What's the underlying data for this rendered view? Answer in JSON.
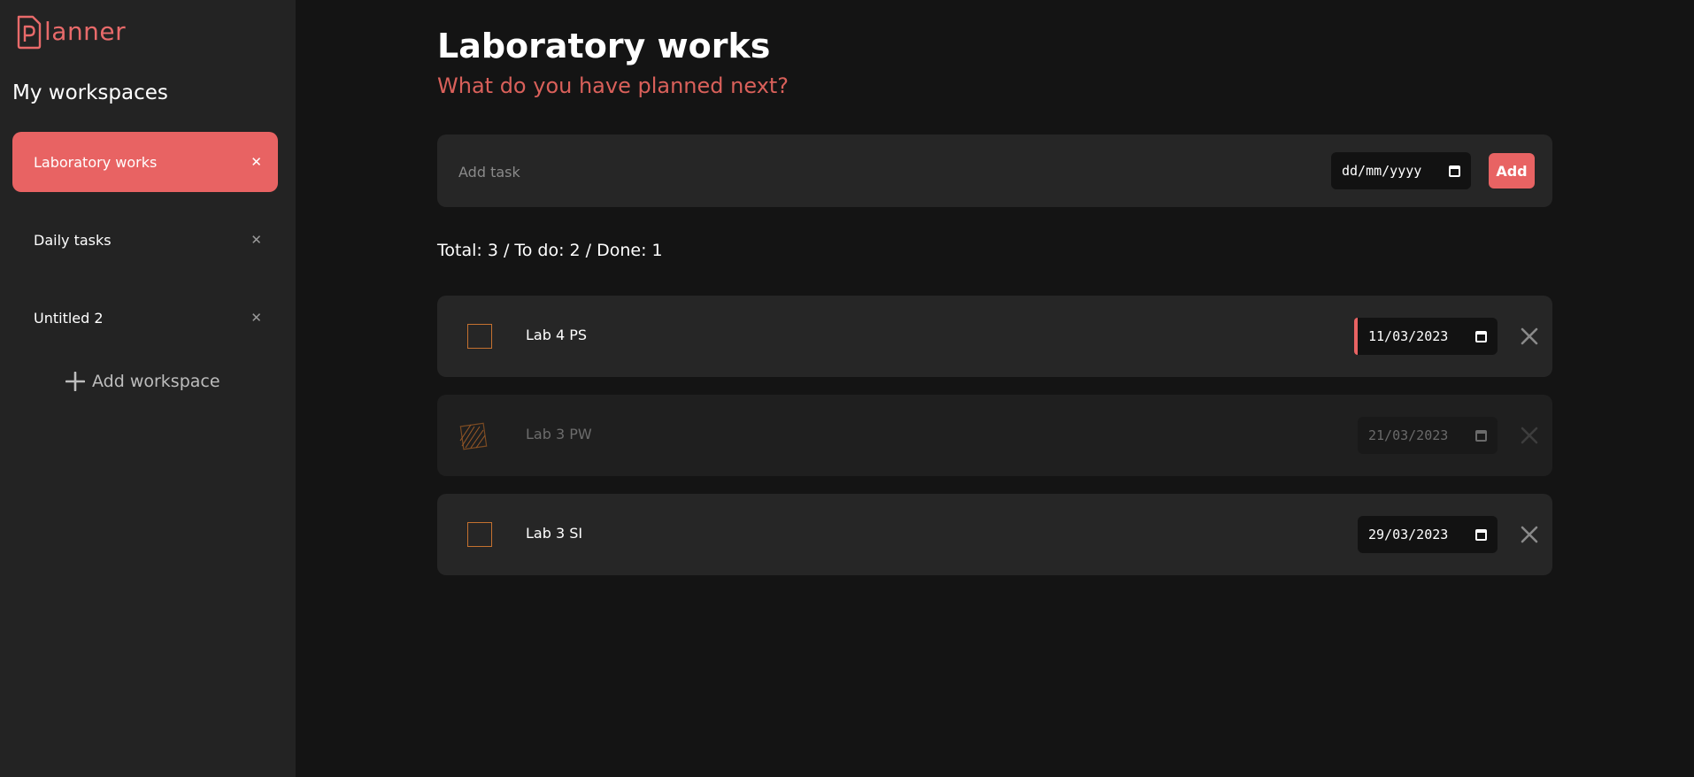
{
  "app": {
    "logo_text": "lanner",
    "logo_initial": "P",
    "accent": "#e86363"
  },
  "sidebar": {
    "heading": "My workspaces",
    "workspaces": [
      {
        "label": "Laboratory works",
        "active": true
      },
      {
        "label": "Daily tasks",
        "active": false
      },
      {
        "label": "Untitled 2",
        "active": false
      }
    ],
    "close_glyph": "✕",
    "add_label": "Add workspace",
    "add_icon": "plus-icon"
  },
  "main": {
    "title": "Laboratory works",
    "subtitle": "What do you have planned next?",
    "add_task": {
      "placeholder": "Add task",
      "date_placeholder": "dd/mm/yyyy",
      "button_label": "Add"
    },
    "stats": "Total: 3 / To do: 2 / Done: 1",
    "tasks": [
      {
        "label": "Lab 4 PS",
        "date": "11/03/2023",
        "done": false,
        "overdue": true
      },
      {
        "label": "Lab 3 PW",
        "date": "21/03/2023",
        "done": true,
        "overdue": false
      },
      {
        "label": "Lab 3 SI",
        "date": "29/03/2023",
        "done": false,
        "overdue": false
      }
    ]
  }
}
